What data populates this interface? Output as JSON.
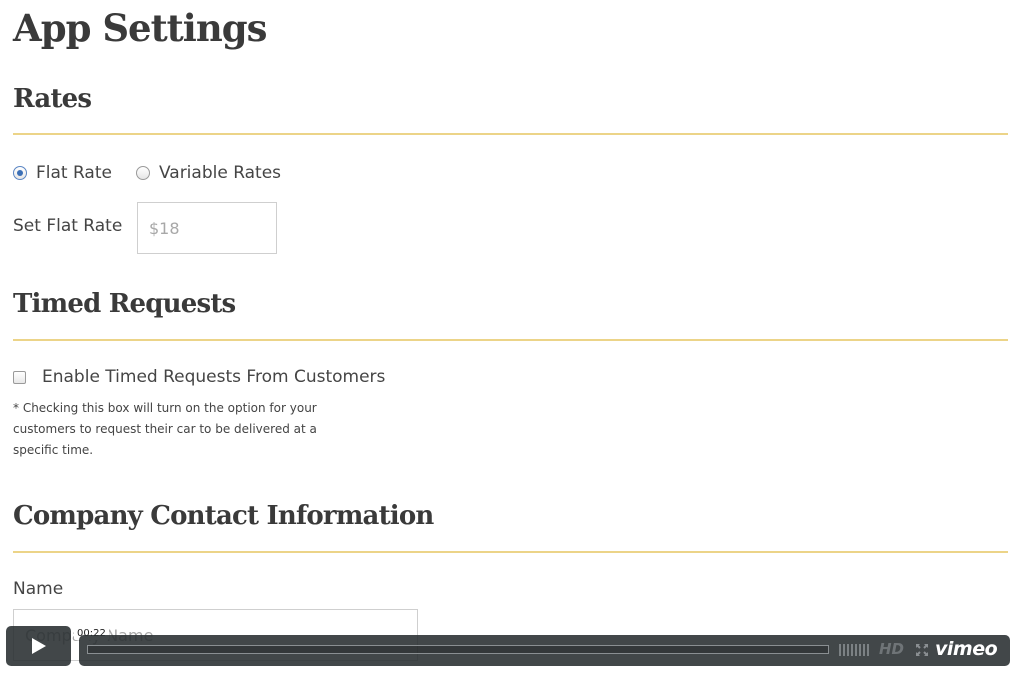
{
  "page": {
    "title": "App Settings"
  },
  "rates": {
    "heading": "Rates",
    "options": [
      {
        "label": "Flat Rate",
        "checked": true
      },
      {
        "label": "Variable Rates",
        "checked": false
      }
    ],
    "flat_rate_label": "Set Flat Rate",
    "flat_rate_placeholder": "$18"
  },
  "timed_requests": {
    "heading": "Timed Requests",
    "checkbox_label": "Enable Timed Requests From Customers",
    "checked": false,
    "help_text": "* Checking this box will turn on the option for your customers to request their car to be delivered at a specific time."
  },
  "company_contact": {
    "heading": "Company Contact Information",
    "name_label": "Name",
    "name_placeholder": "Company Name"
  },
  "video_player": {
    "timecode": "00:22",
    "progress": 0,
    "hd_label": "HD",
    "logo": "vimeo",
    "icons": {
      "play": "play-icon",
      "volume": "volume-icon",
      "fullscreen": "fullscreen-icon"
    },
    "colors": {
      "bar": "#282d30",
      "accent_divider": "#ecd488"
    }
  }
}
